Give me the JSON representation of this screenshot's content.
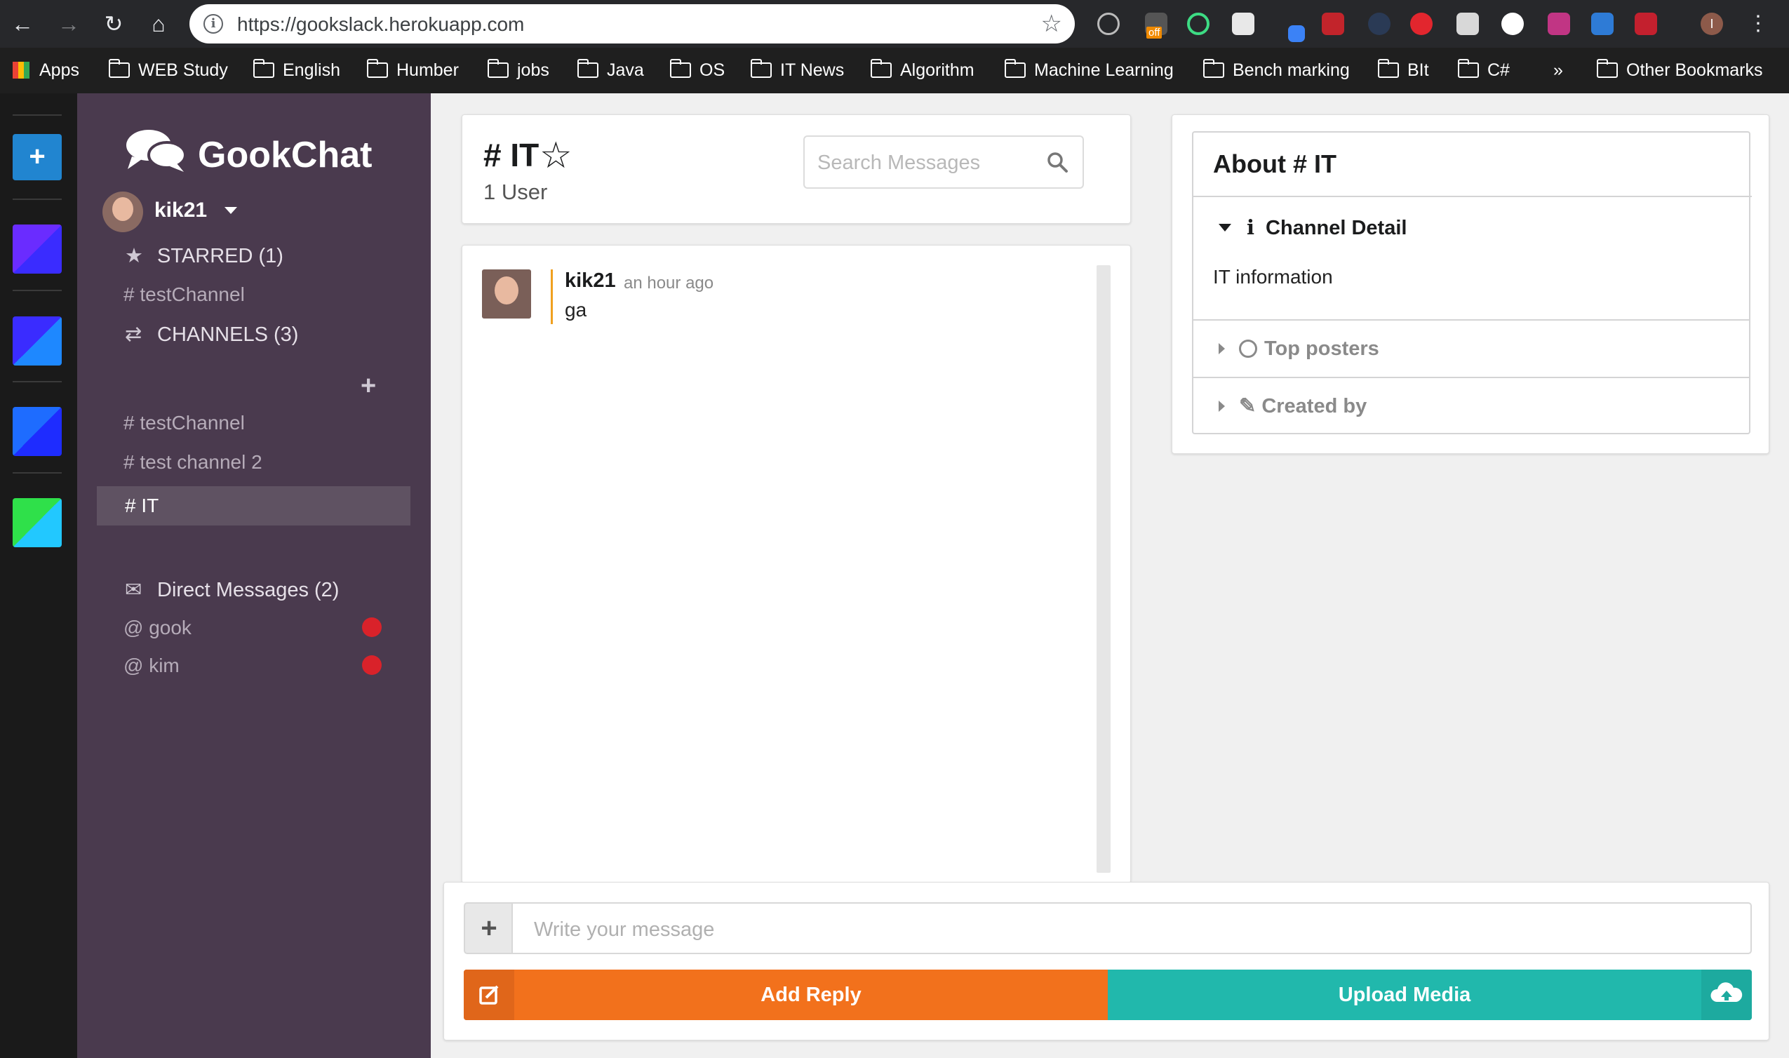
{
  "browser": {
    "url": "https://gookslack.herokuapp.com",
    "bookmarks": [
      "Apps",
      "WEB Study",
      "English",
      "Humber",
      "jobs",
      "Java",
      "OS",
      "IT News",
      "Algorithm",
      "Machine Learning",
      "Bench marking",
      "BIt",
      "C#"
    ],
    "overflow": "»",
    "other_bookmarks": "Other Bookmarks",
    "extension_badge": "off",
    "profile_initial": "I"
  },
  "rail": {
    "add_label": "+"
  },
  "sidebar": {
    "brand": "GookChat",
    "user": "kik21",
    "starred_header": "STARRED (1)",
    "starred": [
      "# testChannel"
    ],
    "channels_header": "CHANNELS (3)",
    "channels": [
      "# testChannel",
      "# test channel 2",
      "# IT"
    ],
    "active_channel": "# IT",
    "dm_header": "Direct Messages (2)",
    "dms": [
      "@ gook",
      "@ kim"
    ],
    "status_color": "#d9222a"
  },
  "channel": {
    "title": "# IT",
    "users": "1 User",
    "search_placeholder": "Search Messages"
  },
  "messages": [
    {
      "author": "kik21",
      "time": "an hour ago",
      "text": "ga"
    }
  ],
  "about": {
    "title": "About # IT",
    "detail_header": "Channel Detail",
    "detail_text": "IT information",
    "posters_header": "Top posters",
    "created_header": "Created by"
  },
  "compose": {
    "placeholder": "Write your message",
    "reply_label": "Add Reply",
    "upload_label": "Upload Media"
  },
  "colors": {
    "sidebar": "#4a3a4e",
    "reply": "#f2711c",
    "upload": "#21b8ac"
  }
}
